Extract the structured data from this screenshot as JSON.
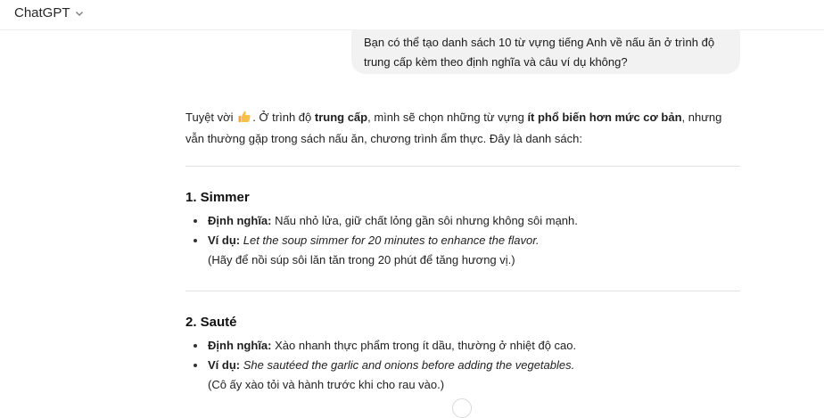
{
  "header": {
    "model_name": "ChatGPT",
    "chevron_icon": "chevron-down-icon"
  },
  "user_message": {
    "text": "Bạn có thể tạo danh sách 10 từ vựng tiếng Anh về nấu ăn ở trình độ trung cấp kèm theo định nghĩa và câu ví dụ không?"
  },
  "assistant": {
    "intro_1": "Tuyệt vời",
    "intro_emoji": "thumbs-up-icon",
    "intro_2": ". Ở trình độ ",
    "intro_bold_1": "trung cấp",
    "intro_3": ", mình sẽ chọn những từ vựng ",
    "intro_bold_2": "ít phổ biến hơn mức cơ bản",
    "intro_4": ", nhưng vẫn thường gặp trong sách nấu ăn, chương trình ẩm thực. Đây là danh sách:",
    "sections": [
      {
        "title": "1. Simmer",
        "def_label": "Định nghĩa:",
        "def_text": " Nấu nhỏ lửa, giữ chất lỏng gần sôi nhưng không sôi mạnh.",
        "ex_label": "Ví dụ:",
        "ex_text": "Let the soup simmer for 20 minutes to enhance the flavor.",
        "translation": "(Hãy để nồi súp sôi lăn tăn trong 20 phút để tăng hương vị.)"
      },
      {
        "title": "2. Sauté",
        "def_label": "Định nghĩa:",
        "def_text": " Xào nhanh thực phẩm trong ít dầu, thường ở nhiệt độ cao.",
        "ex_label": "Ví dụ:",
        "ex_text": "She sautéed the garlic and onions before adding the vegetables.",
        "translation": "(Cô ấy xào tỏi và hành trước khi cho rau vào.)"
      }
    ]
  }
}
